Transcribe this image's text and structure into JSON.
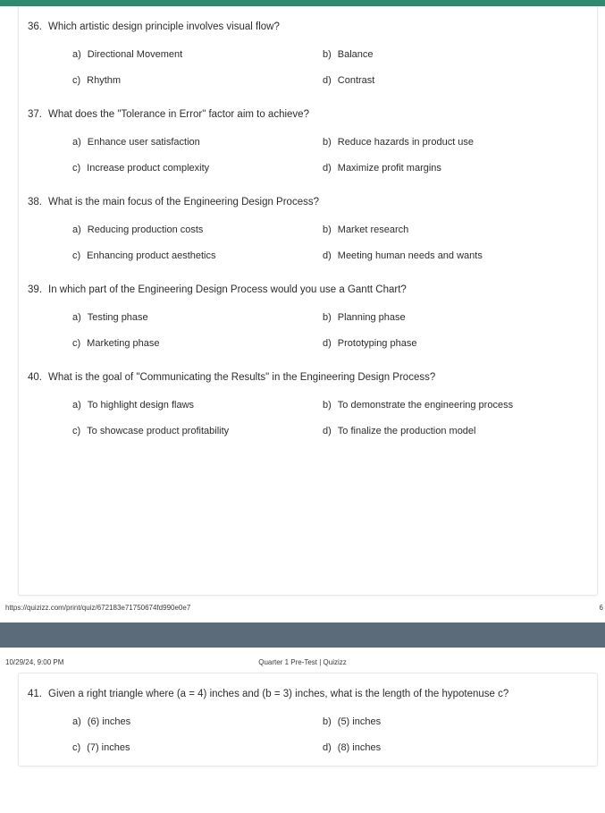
{
  "document": {
    "title": "Quarter 1 Pre-Test | Quizizz",
    "timestamp": "10/29/24, 9:00 PM",
    "print_url": "https://quizizz.com/print/quiz/672183e71750674fd990e0e7",
    "page_number": "6"
  },
  "theme": {
    "accent_green": "#2e8b6f",
    "divider_gray": "#5c6b7a",
    "paper_white": "#ffffff",
    "text_color": "#2d2d2d"
  },
  "page_one": {
    "questions": [
      {
        "number": "36.",
        "text": "Which artistic design principle involves visual flow?",
        "options": [
          {
            "letter": "a)",
            "text": "Directional Movement"
          },
          {
            "letter": "b)",
            "text": "Balance"
          },
          {
            "letter": "c)",
            "text": "Rhythm"
          },
          {
            "letter": "d)",
            "text": "Contrast"
          }
        ]
      },
      {
        "number": "37.",
        "text": "What does the \"Tolerance in Error\" factor aim to achieve?",
        "options": [
          {
            "letter": "a)",
            "text": "Enhance user satisfaction"
          },
          {
            "letter": "b)",
            "text": "Reduce hazards in product use"
          },
          {
            "letter": "c)",
            "text": "Increase product complexity"
          },
          {
            "letter": "d)",
            "text": "Maximize profit margins"
          }
        ]
      },
      {
        "number": "38.",
        "text": "What is the main focus of the Engineering Design Process?",
        "options": [
          {
            "letter": "a)",
            "text": "Reducing production costs"
          },
          {
            "letter": "b)",
            "text": "Market research"
          },
          {
            "letter": "c)",
            "text": "Enhancing product aesthetics"
          },
          {
            "letter": "d)",
            "text": "Meeting human needs and wants"
          }
        ]
      },
      {
        "number": "39.",
        "text": "In which part of the Engineering Design Process would you use a Gantt Chart?",
        "options": [
          {
            "letter": "a)",
            "text": "Testing phase"
          },
          {
            "letter": "b)",
            "text": "Planning phase"
          },
          {
            "letter": "c)",
            "text": "Marketing phase"
          },
          {
            "letter": "d)",
            "text": "Prototyping phase"
          }
        ]
      },
      {
        "number": "40.",
        "text": "What is the goal of \"Communicating the Results\" in the Engineering Design Process?",
        "options": [
          {
            "letter": "a)",
            "text": "To highlight design flaws"
          },
          {
            "letter": "b)",
            "text": "To demonstrate the engineering process"
          },
          {
            "letter": "c)",
            "text": "To showcase product profitability"
          },
          {
            "letter": "d)",
            "text": "To finalize the production model"
          }
        ]
      }
    ]
  },
  "page_two": {
    "questions": [
      {
        "number": "41.",
        "text": "Given a right triangle where (a = 4) inches and (b = 3) inches, what is the length of the hypotenuse c?",
        "options": [
          {
            "letter": "a)",
            "text": "(6) inches"
          },
          {
            "letter": "b)",
            "text": "(5) inches"
          },
          {
            "letter": "c)",
            "text": "(7) inches"
          },
          {
            "letter": "d)",
            "text": "(8) inches"
          }
        ]
      }
    ]
  }
}
